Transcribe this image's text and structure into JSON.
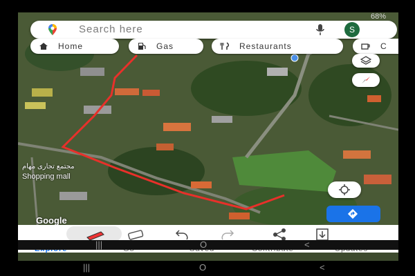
{
  "status": {
    "battery": "68%"
  },
  "search": {
    "placeholder": "Search here",
    "avatar": "S"
  },
  "chips": [
    {
      "label": "Home",
      "icon": "home-icon"
    },
    {
      "label": "Gas",
      "icon": "gas-icon"
    },
    {
      "label": "Restaurants",
      "icon": "restaurant-icon"
    },
    {
      "label": "C",
      "icon": "coffee-icon"
    }
  ],
  "map": {
    "place_label": "Shopping mall",
    "place_label_local": "مجتمع تجاری مهام",
    "watermark": "Google",
    "route_color": "#e8302a"
  },
  "bottom_nav": {
    "tabs": [
      "Explore",
      "Go",
      "Saved",
      "Contribute",
      "Updates"
    ],
    "active": "Explore",
    "accent": "#1a73e8"
  },
  "system_nav": {
    "recents": "|||",
    "home": "O",
    "back": "<"
  }
}
